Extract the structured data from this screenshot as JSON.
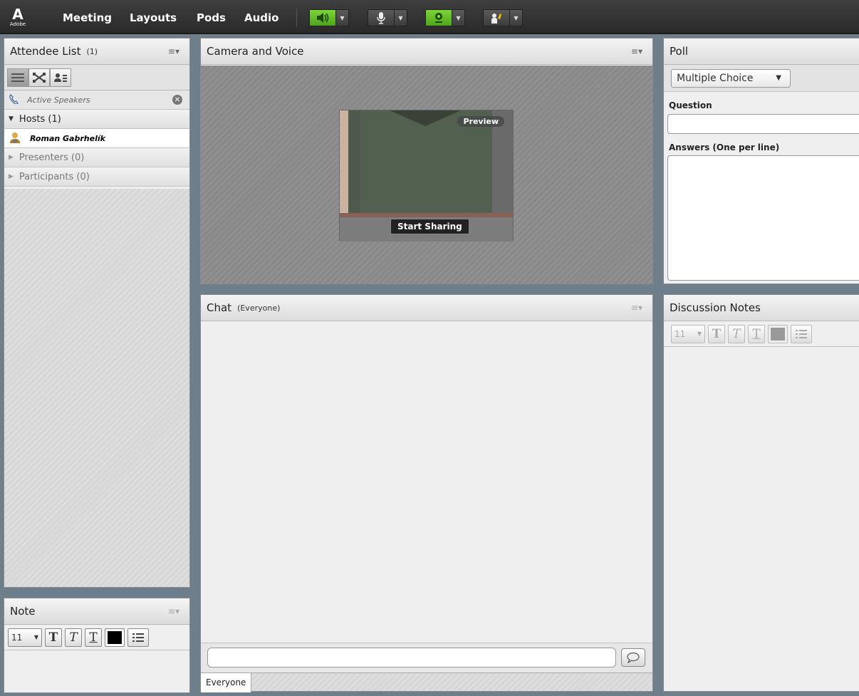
{
  "menubar": {
    "logo_mark": "A",
    "logo_text": "Adobe",
    "items": [
      "Meeting",
      "Layouts",
      "Pods",
      "Audio"
    ]
  },
  "attendee": {
    "title": "Attendee List",
    "count": "(1)",
    "active_speakers": "Active Speakers",
    "hosts": "Hosts (1)",
    "host_name": "Roman Gabrhelík",
    "presenters": "Presenters (0)",
    "participants": "Participants (0)"
  },
  "note": {
    "title": "Note",
    "font_size": "11"
  },
  "camera": {
    "title": "Camera and Voice",
    "preview": "Preview",
    "start_sharing": "Start Sharing"
  },
  "chat": {
    "title": "Chat",
    "scope": "(Everyone)",
    "tab_everyone": "Everyone",
    "input_value": ""
  },
  "poll": {
    "title": "Poll",
    "type": "Multiple Choice",
    "question_label": "Question",
    "question_value": "",
    "answers_label": "Answers (One per line)",
    "answers_value": ""
  },
  "discussion": {
    "title": "Discussion Notes",
    "font_size": "11"
  },
  "colors": {
    "accent_green": "#6cc428",
    "menubar_bg": "#333333",
    "app_bg": "#6e7e8a"
  }
}
